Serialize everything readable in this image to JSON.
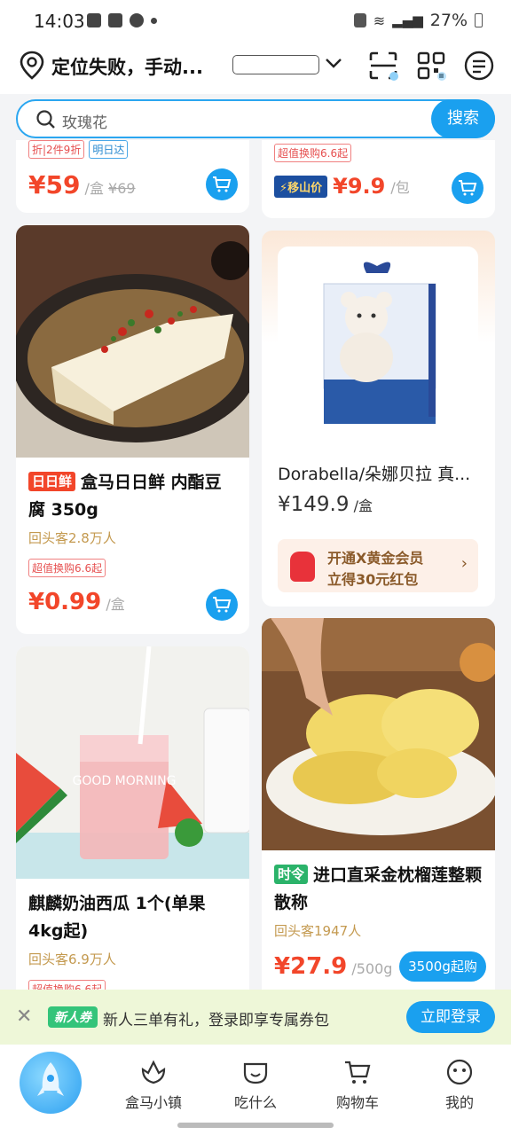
{
  "status_bar": {
    "time": "14:03",
    "battery": "27%"
  },
  "header": {
    "location_text": "定位失败，手动..."
  },
  "search": {
    "placeholder": "玫瑰花",
    "button": "搜索"
  },
  "products": {
    "top_left": {
      "tags": [
        "折|2件9折",
        "明日达"
      ],
      "price": "¥59",
      "unit": "/盒",
      "old_price": "¥69"
    },
    "top_right": {
      "tag": "超值换购6.6起",
      "label": "移山价",
      "price": "¥9.9",
      "unit": "/包"
    },
    "tofu": {
      "badge": "日日鲜",
      "title": "盒马日日鲜 内酯豆腐 350g",
      "repeat": "回头客2.8万人",
      "tag": "超值换购6.6起",
      "price": "¥0.99",
      "unit": "/盒"
    },
    "bear": {
      "title": "Dorabella/朵娜贝拉 真...",
      "price": "¥149.9",
      "unit": "/盒",
      "promo_line1": "开通X黄金会员",
      "promo_line2": "立得30元红包"
    },
    "watermelon": {
      "title": "麒麟奶油西瓜 1个(单果4kg起)",
      "repeat": "回头客6.9万人",
      "tag": "超值换购6.6起",
      "image_text": "GOOD MORNING"
    },
    "durian": {
      "badge": "时令",
      "title": "进口直采金枕榴莲整颗 散称",
      "repeat": "回头客1947人",
      "price": "¥27.9",
      "unit": "/500g",
      "min": "3500g起购"
    }
  },
  "coupon_bar": {
    "chip": "新人券",
    "text": "新人三单有礼，登录即享专属券包",
    "button": "立即登录"
  },
  "tabbar": {
    "items": [
      "盒马小镇",
      "吃什么",
      "购物车",
      "我的"
    ]
  },
  "colors": {
    "accent": "#1aa0ef",
    "price": "#f2462a"
  }
}
